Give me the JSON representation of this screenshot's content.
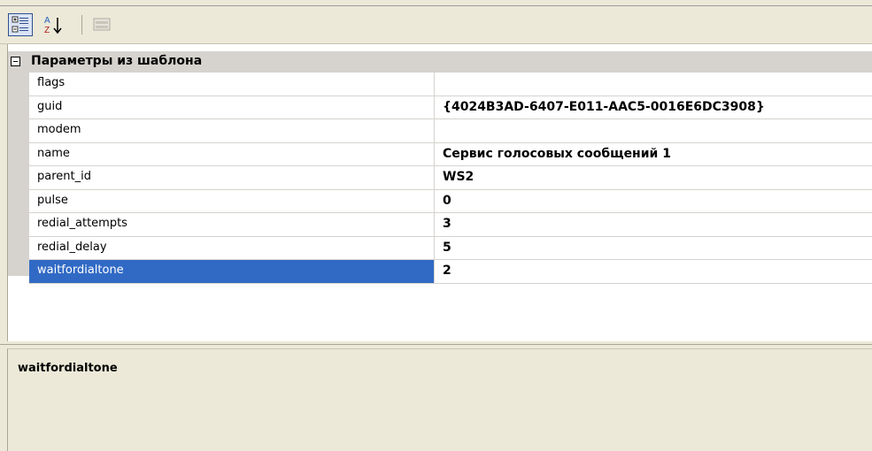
{
  "toolbar": {
    "categorized_button": "categorized-view-icon",
    "alphabetical_button": "sort-az-icon",
    "property_pages_button": "property-pages-icon"
  },
  "category": {
    "label": "Параметры из шаблона",
    "expanded": true
  },
  "properties": [
    {
      "name": "flags",
      "value": ""
    },
    {
      "name": "guid",
      "value": "{4024B3AD-6407-E011-AAC5-0016E6DC3908}"
    },
    {
      "name": "modem",
      "value": ""
    },
    {
      "name": "name",
      "value": "Сервис голосовых сообщений 1"
    },
    {
      "name": "parent_id",
      "value": "WS2"
    },
    {
      "name": "pulse",
      "value": "0"
    },
    {
      "name": "redial_attempts",
      "value": "3"
    },
    {
      "name": "redial_delay",
      "value": "5"
    },
    {
      "name": "waitfordialtone",
      "value": "2"
    }
  ],
  "selected_property": "waitfordialtone",
  "help": {
    "title": "waitfordialtone",
    "description": ""
  },
  "colors": {
    "selection": "#316ac5",
    "category_bg": "#d6d3ce",
    "panel_bg": "#ece9d8"
  }
}
